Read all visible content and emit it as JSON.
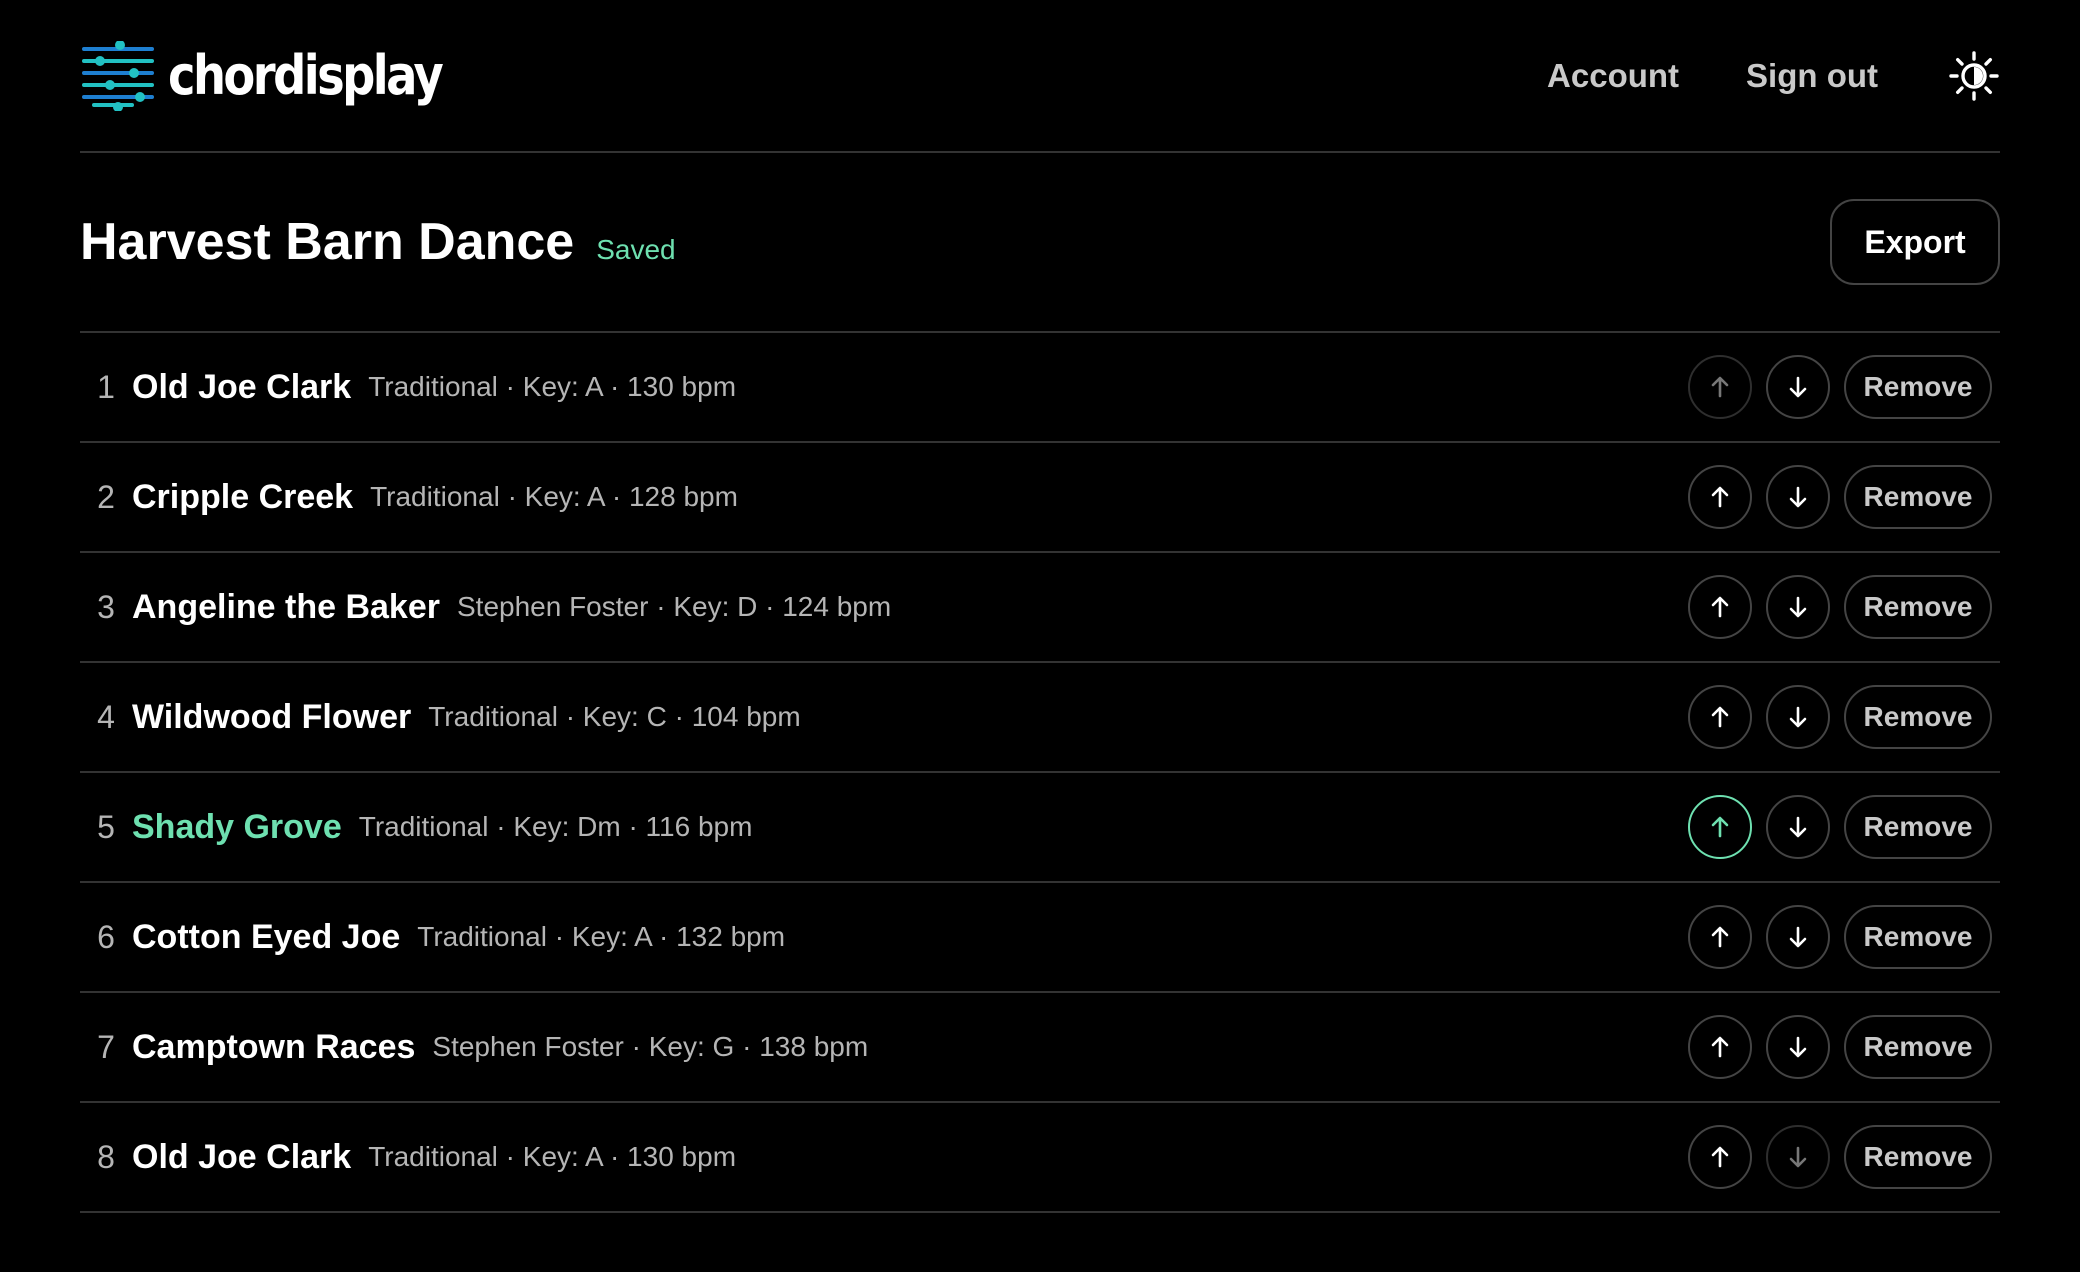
{
  "app": {
    "name": "chordisplay",
    "logo_icon": "equalizer-logo-icon",
    "brand_colors": {
      "cyan": "#22c1c3",
      "blue": "#1e7fd1",
      "green": "#6ee0b0"
    }
  },
  "nav": {
    "account_label": "Account",
    "signout_label": "Sign out",
    "theme_icon": "sun-icon"
  },
  "setlist": {
    "title": "Harvest Barn Dance",
    "status": "Saved",
    "export_label": "Export"
  },
  "songs": [
    {
      "index": "1",
      "title": "Old Joe Clark",
      "meta": "Traditional · Key: A · 130 bpm",
      "up_enabled": false,
      "down_enabled": true,
      "active": false,
      "remove_label": "Remove"
    },
    {
      "index": "2",
      "title": "Cripple Creek",
      "meta": "Traditional · Key: A · 128 bpm",
      "up_enabled": true,
      "down_enabled": true,
      "active": false,
      "remove_label": "Remove"
    },
    {
      "index": "3",
      "title": "Angeline the Baker",
      "meta": "Stephen Foster · Key: D · 124 bpm",
      "up_enabled": true,
      "down_enabled": true,
      "active": false,
      "remove_label": "Remove"
    },
    {
      "index": "4",
      "title": "Wildwood Flower",
      "meta": "Traditional · Key: C · 104 bpm",
      "up_enabled": true,
      "down_enabled": true,
      "active": false,
      "remove_label": "Remove"
    },
    {
      "index": "5",
      "title": "Shady Grove",
      "meta": "Traditional · Key: Dm · 116 bpm",
      "up_enabled": true,
      "down_enabled": true,
      "active": true,
      "remove_label": "Remove"
    },
    {
      "index": "6",
      "title": "Cotton Eyed Joe",
      "meta": "Traditional · Key: A · 132 bpm",
      "up_enabled": true,
      "down_enabled": true,
      "active": false,
      "remove_label": "Remove"
    },
    {
      "index": "7",
      "title": "Camptown Races",
      "meta": "Stephen Foster · Key: G · 138 bpm",
      "up_enabled": true,
      "down_enabled": true,
      "active": false,
      "remove_label": "Remove"
    },
    {
      "index": "8",
      "title": "Old Joe Clark",
      "meta": "Traditional · Key: A · 130 bpm",
      "up_enabled": true,
      "down_enabled": false,
      "active": false,
      "remove_label": "Remove"
    }
  ]
}
